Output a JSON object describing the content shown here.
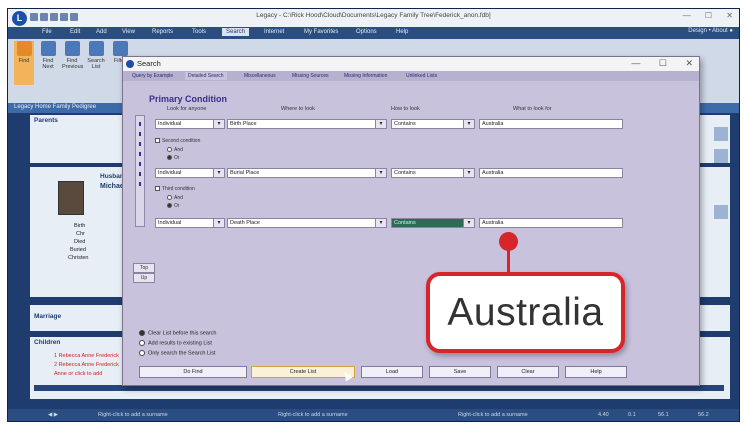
{
  "app": {
    "title": "Legacy - C:\\Rick Hood\\Cloud\\Documents\\Legacy Family Tree\\Federick_anon.fdb]",
    "logo_letter": "L",
    "window_controls": [
      "—",
      "☐",
      "✕"
    ]
  },
  "menu": {
    "items": [
      "File",
      "Edit",
      "Add",
      "View",
      "Reports",
      "Tools",
      "Search",
      "Internet",
      "My Favorites",
      "Options",
      "Help"
    ],
    "active": "Search",
    "right_text": "Design  •  About  ●"
  },
  "ribbon": {
    "buttons": [
      "Find",
      "Find Next",
      "Find Previous",
      "Search List",
      "Filter"
    ]
  },
  "navbar": {
    "text": "Legacy Home  Family  Pedigree"
  },
  "background": {
    "parents_header": "Parents",
    "husband_header": "Husband",
    "husband_name": "Michael",
    "fact_labels": [
      "Birth",
      "Chr",
      "Died",
      "Buried",
      "Christen"
    ],
    "marriage_header": "Marriage",
    "children_header": "Children",
    "children_rows": [
      "1  Rebecca Anne Frederick",
      "2  Rebecca Anne Frederick",
      "   Anne or click to add"
    ]
  },
  "status": {
    "segments": [
      "Right-click to add a surname",
      "Right-click to add a surname",
      "Right-click to add a surname",
      "4.40",
      "0.1",
      "56.1",
      "56.2"
    ]
  },
  "dialog": {
    "title": "Search",
    "tabs": [
      "Query by Example",
      "Detailed Search",
      "Miscellaneous",
      "Missing Sources",
      "Missing Information",
      "Unlinked Lists"
    ],
    "active_tab": "Detailed Search",
    "section_title": "Primary Condition",
    "columns": [
      "Look for anyone",
      "Where to look",
      "How to look",
      "What to look for"
    ],
    "conditions": [
      {
        "who": "Individual",
        "field": "Birth Place",
        "how": "Contains",
        "value": "Australia"
      },
      {
        "who": "Individual",
        "field": "Burial Place",
        "how": "Contains",
        "value": "Australia"
      },
      {
        "who": "Individual",
        "field": "Death Place",
        "how": "Contains",
        "value": "Australia"
      }
    ],
    "second_condition_label": "Second condition",
    "third_condition_label": "Third condition",
    "and_label": "And",
    "or_label": "Or",
    "updown_top": "Top",
    "updown_bottom": "Up",
    "options": [
      "Clear List before this search",
      "Add results to existing List",
      "Only search the Search List"
    ],
    "buttons": [
      "Do Find",
      "Create List",
      "Load",
      "Save",
      "Clear",
      "Help"
    ]
  },
  "callout": {
    "text": "Australia"
  }
}
